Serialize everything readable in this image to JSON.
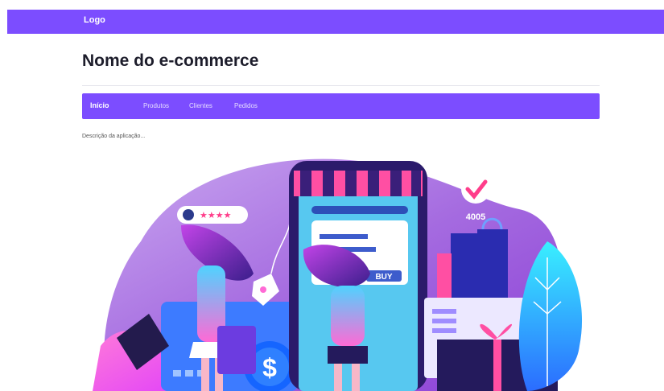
{
  "header": {
    "logo": "Logo"
  },
  "page": {
    "title": "Nome do e-commerce",
    "description": "Descrição da aplicação..."
  },
  "nav": {
    "items": [
      {
        "label": "Início",
        "active": true
      },
      {
        "label": "Produtos",
        "active": false
      },
      {
        "label": "Clientes",
        "active": false
      },
      {
        "label": "Pedidos",
        "active": false
      }
    ]
  },
  "illustration": {
    "badge_count": "4005",
    "buy_label": "BUY",
    "currency_symbol": "$",
    "rating_stars": "★★★★"
  },
  "colors": {
    "brand": "#7c4dff"
  }
}
